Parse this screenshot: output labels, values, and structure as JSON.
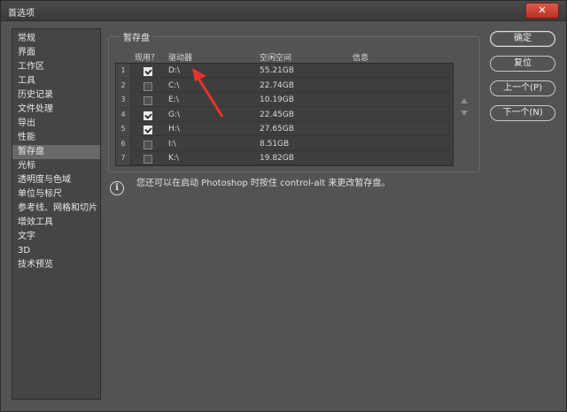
{
  "window": {
    "title": "首选项",
    "close_glyph": "✕"
  },
  "sidebar": {
    "items": [
      {
        "label": "常规"
      },
      {
        "label": "界面"
      },
      {
        "label": "工作区"
      },
      {
        "label": "工具"
      },
      {
        "label": "历史记录"
      },
      {
        "label": "文件处理"
      },
      {
        "label": "导出"
      },
      {
        "label": "性能"
      },
      {
        "label": "暂存盘",
        "selected": true
      },
      {
        "label": "光标"
      },
      {
        "label": "透明度与色域"
      },
      {
        "label": "单位与标尺"
      },
      {
        "label": "参考线、网格和切片"
      },
      {
        "label": "增效工具"
      },
      {
        "label": "文字"
      },
      {
        "label": "3D"
      },
      {
        "label": "技术预览"
      }
    ]
  },
  "scratch": {
    "group_label": "暂存盘",
    "headers": {
      "active": "现用？",
      "drive": "驱动器",
      "free": "空闲空间",
      "info": "信息"
    },
    "rows": [
      {
        "num": "1",
        "checked": true,
        "drive": "D:\\",
        "free": "55.21GB"
      },
      {
        "num": "2",
        "checked": false,
        "drive": "C:\\",
        "free": "22.74GB"
      },
      {
        "num": "3",
        "checked": false,
        "drive": "E:\\",
        "free": "10.19GB"
      },
      {
        "num": "4",
        "checked": true,
        "drive": "G:\\",
        "free": "22.45GB"
      },
      {
        "num": "5",
        "checked": true,
        "drive": "H:\\",
        "free": "27.65GB"
      },
      {
        "num": "6",
        "checked": false,
        "drive": "I:\\",
        "free": "8.51GB"
      },
      {
        "num": "7",
        "checked": false,
        "drive": "K:\\",
        "free": "19.82GB"
      }
    ],
    "info_text": "您还可以在启动 Photoshop 时按住 control-alt 来更改暂存盘。"
  },
  "buttons": {
    "ok": "确定",
    "reset": "复位",
    "prev": "上一个(P)",
    "next": "下一个(N)"
  },
  "colors": {
    "annotation_arrow": "#e8332b"
  }
}
